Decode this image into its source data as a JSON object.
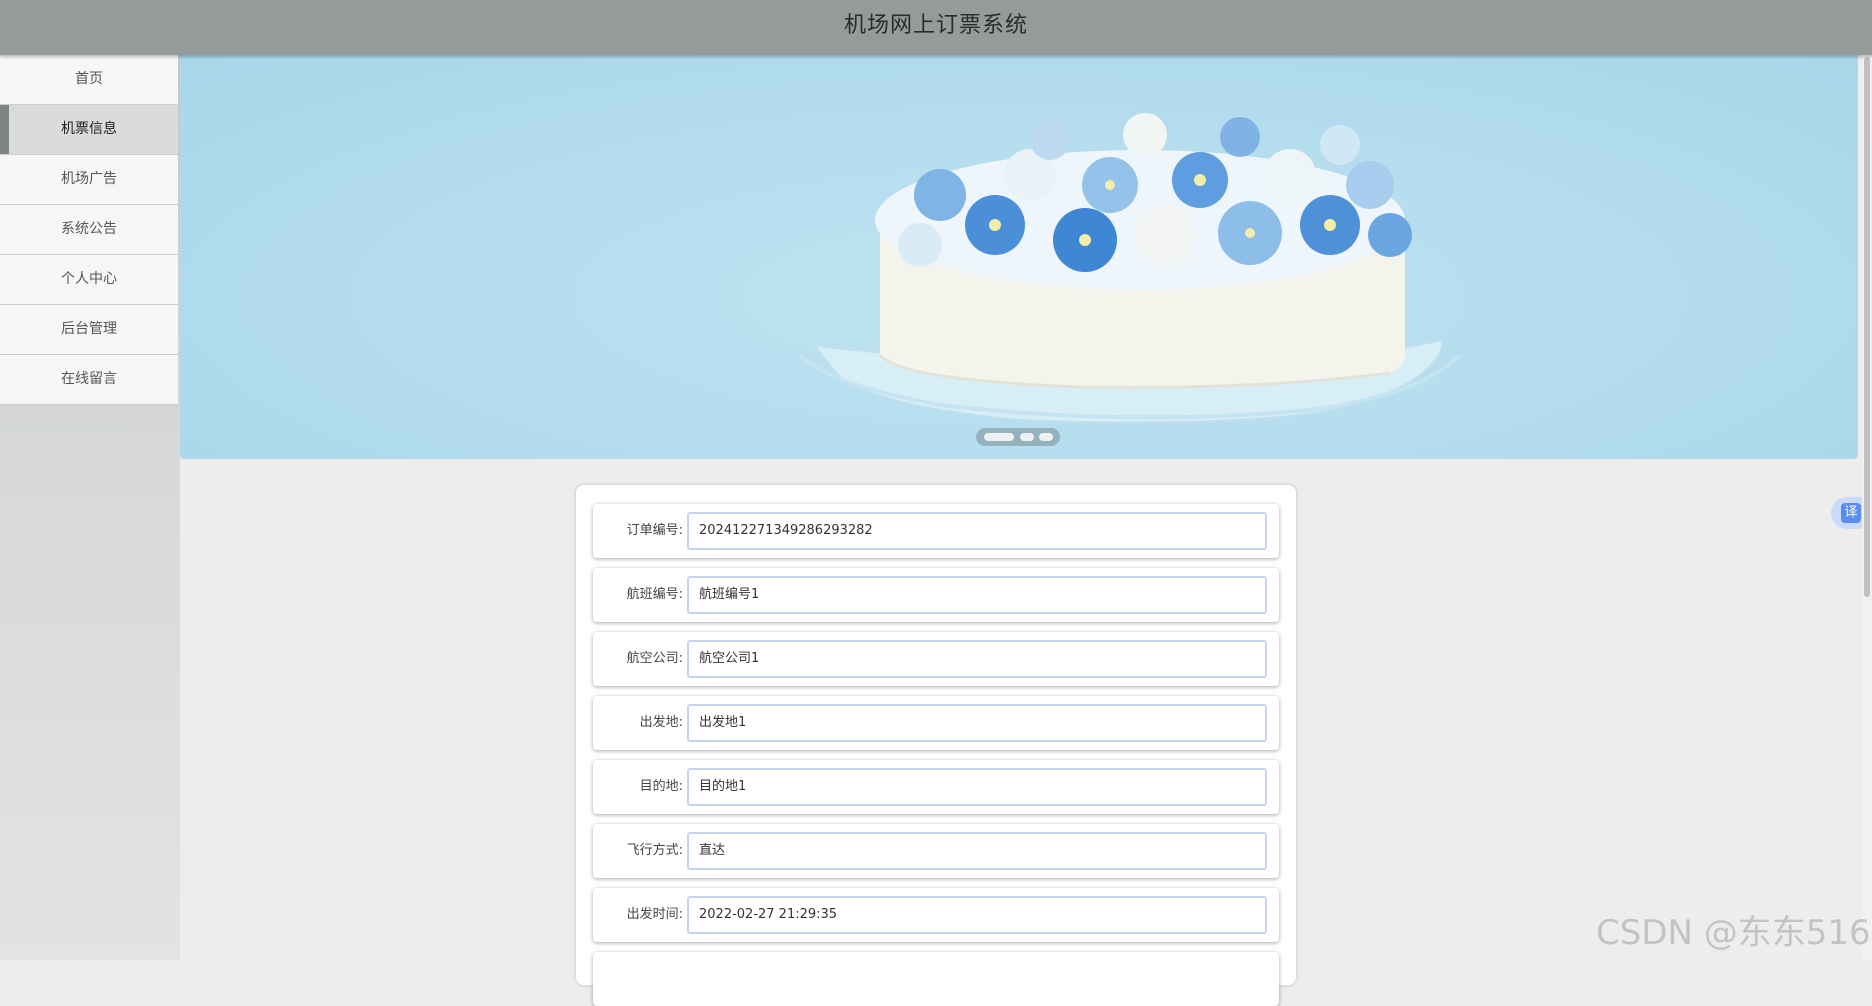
{
  "app": {
    "title": "机场网上订票系统"
  },
  "sidebar": {
    "items": [
      {
        "label": "首页",
        "active": false
      },
      {
        "label": "机票信息",
        "active": true
      },
      {
        "label": "机场广告",
        "active": false
      },
      {
        "label": "系统公告",
        "active": false
      },
      {
        "label": "个人中心",
        "active": false
      },
      {
        "label": "后台管理",
        "active": false
      },
      {
        "label": "在线留言",
        "active": false
      }
    ]
  },
  "banner": {
    "slides_count": 3,
    "active_slide": 1
  },
  "form": {
    "fields": [
      {
        "label": "订单编号:",
        "value": "20241227134928629​3282"
      },
      {
        "label": "航班编号:",
        "value": "航班编号1"
      },
      {
        "label": "航空公司:",
        "value": "航空公司1"
      },
      {
        "label": "出发地:",
        "value": "出发地1"
      },
      {
        "label": "目的地:",
        "value": "目的地1"
      },
      {
        "label": "飞行方式:",
        "value": "直达"
      },
      {
        "label": "出发时间:",
        "value": "2022-02-27 21:29:35"
      }
    ]
  },
  "translate": {
    "label": "译"
  },
  "watermark": {
    "text": "CSDN @东东516"
  },
  "colors": {
    "topbar": "#959a9a",
    "sidebar_active": "#d9dcd9",
    "banner_sky": "#b3dcee",
    "field_border": "#c6d5ea"
  }
}
